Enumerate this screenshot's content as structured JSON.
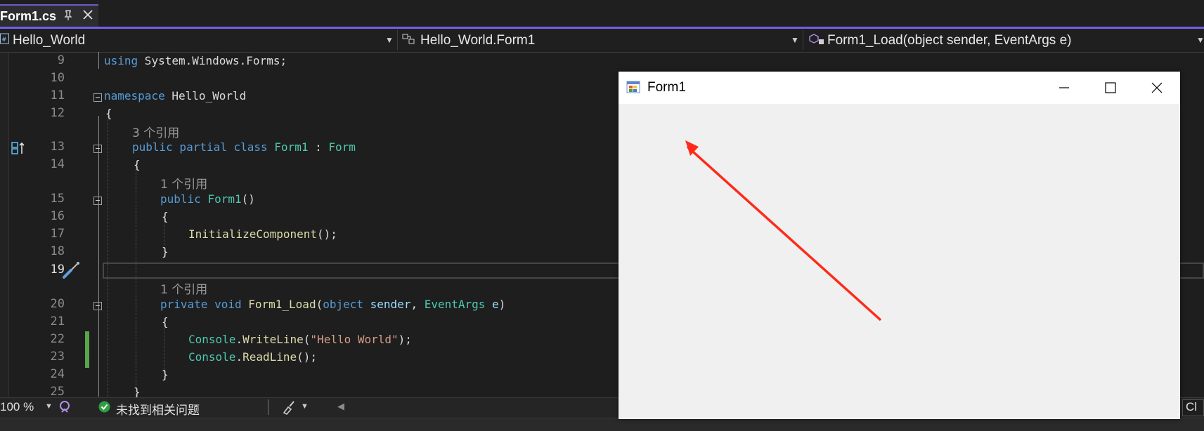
{
  "tab": {
    "title": "Form1.cs",
    "pin_glyph": "⌲",
    "close_glyph": "✕"
  },
  "nav": {
    "project": "Hello_World",
    "class": "Hello_World.Form1",
    "member": "Form1_Load(object sender, EventArgs e)"
  },
  "editor": {
    "line_numbers": [
      "9",
      "10",
      "11",
      "12",
      "13",
      "14",
      "15",
      "16",
      "17",
      "18",
      "19",
      "20",
      "21",
      "22",
      "23",
      "24",
      "25"
    ],
    "lines": {
      "l9_kw": "using",
      "l9_rest": " System.Windows.Forms;",
      "l11_kw": "namespace",
      "l11_rest": " Hello_World",
      "l12": "{",
      "lens13": "3 个引用",
      "l13_kw1": "public",
      "l13_kw2": " partial",
      "l13_kw3": " class",
      "l13_ty": " Form1",
      "l13_colon": " : ",
      "l13_base": "Form",
      "l14": "{",
      "lens15": "1 个引用",
      "l15_kw": "public",
      "l15_fn": " Form1",
      "l15_rest": "()",
      "l16": "{",
      "l17_fn": "InitializeComponent",
      "l17_rest": "();",
      "l18": "}",
      "lens20": "1 个引用",
      "l20_kw1": "private",
      "l20_kw2": " void",
      "l20_fn": " Form1_Load",
      "l20_p1": "(",
      "l20_kw3": "object",
      "l20_pa1": " sender",
      "l20_c": ", ",
      "l20_ty": "EventArgs",
      "l20_pa2": " e",
      "l20_p2": ")",
      "l21": "{",
      "l22_ty": "Console",
      "l22_dot": ".",
      "l22_fn": "WriteLine",
      "l22_p1": "(",
      "l22_st": "\"Hello World\"",
      "l22_p2": ");",
      "l23_ty": "Console",
      "l23_dot": ".",
      "l23_fn": "ReadLine",
      "l23_p": "();",
      "l24": "}",
      "l25": "}"
    }
  },
  "status": {
    "zoom": "100 %",
    "issues": "未找到相关问题",
    "right_text": "Cl"
  },
  "form_window": {
    "title": "Form1"
  },
  "colors": {
    "accent": "#7160e8",
    "annotation_arrow": "#ff2a1a",
    "change_bar": "#57a64a",
    "issue_ok": "#2ea043"
  }
}
